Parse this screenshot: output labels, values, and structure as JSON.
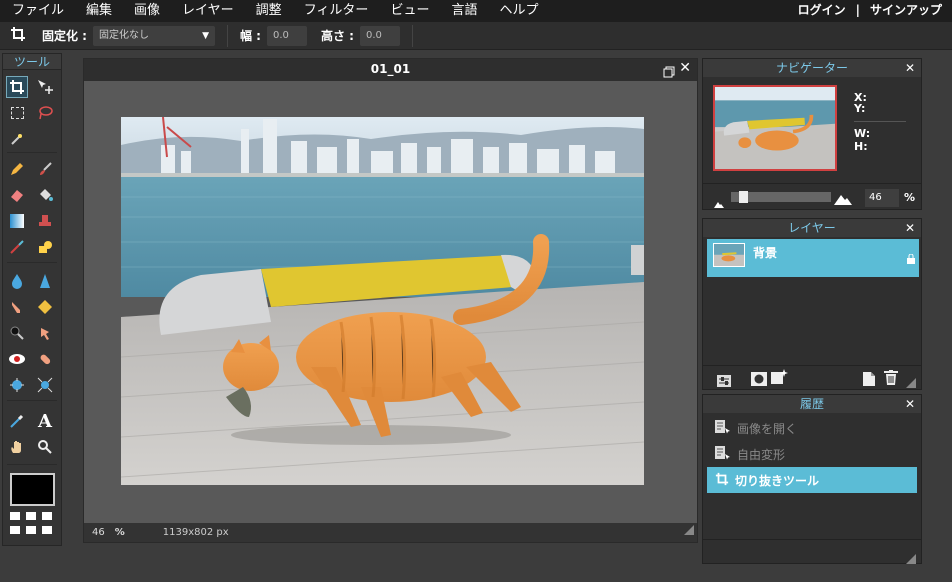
{
  "menubar": {
    "items": [
      "ファイル",
      "編集",
      "画像",
      "レイヤー",
      "調整",
      "フィルター",
      "ビュー",
      "言語",
      "ヘルプ"
    ],
    "login": "ログイン",
    "divider": "|",
    "signup": "サインアップ"
  },
  "optbar": {
    "constraint_label": "固定化 :",
    "constraint_value": "固定化なし",
    "width_label": "幅 :",
    "width_value": "0.0",
    "height_label": "高さ :",
    "height_value": "0.0"
  },
  "tools": {
    "title": "ツール",
    "fg_color": "#000000"
  },
  "document": {
    "title": "01_01",
    "zoom": "46",
    "zoom_unit": "%",
    "size": "1139x802 px"
  },
  "navigator": {
    "title": "ナビゲーター",
    "x_label": "X:",
    "y_label": "Y:",
    "w_label": "W:",
    "h_label": "H:",
    "zoom": "46",
    "zoom_unit": "%",
    "zoom_fraction": 0.46
  },
  "layers": {
    "title": "レイヤー",
    "items": [
      {
        "name": "背景",
        "locked": true
      }
    ]
  },
  "history": {
    "title": "履歴",
    "items": [
      {
        "label": "画像を開く",
        "state": "dim"
      },
      {
        "label": "自由変形",
        "state": "dim"
      },
      {
        "label": "切り抜きツール",
        "state": "selected"
      }
    ]
  },
  "colors": {
    "accent": "#5bbcd6",
    "panel_title": "#7cc8e8"
  }
}
